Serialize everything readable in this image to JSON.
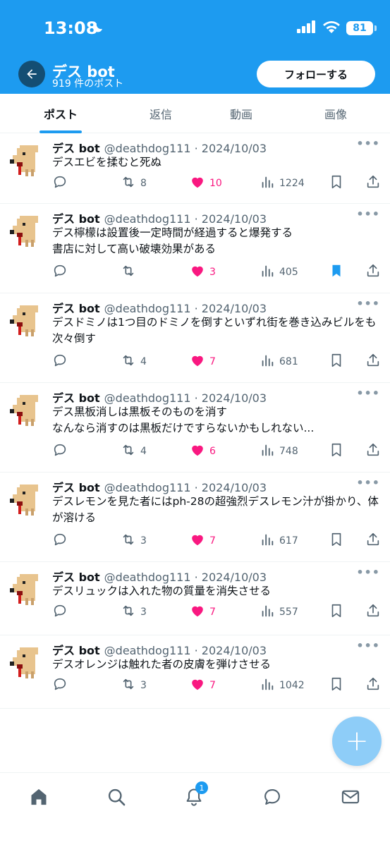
{
  "status": {
    "time": "13:08",
    "battery": "81"
  },
  "header": {
    "name": "デス bot",
    "post_count": "919 件のポスト",
    "follow_label": "フォローする"
  },
  "tabs": [
    {
      "label": "ポスト",
      "active": true
    },
    {
      "label": "返信",
      "active": false
    },
    {
      "label": "動画",
      "active": false
    },
    {
      "label": "画像",
      "active": false
    }
  ],
  "colors": {
    "accent": "#1d9bf0",
    "like": "#f91880",
    "muted": "#536471"
  },
  "posts": [
    {
      "name": "デス bot",
      "handle": "@deathdog111 · 2024/10/03",
      "text": "デスエビを揉むと死ぬ",
      "retweets": "8",
      "likes": "10",
      "views": "1224",
      "bookmarked": false
    },
    {
      "name": "デス bot",
      "handle": "@deathdog111 · 2024/10/03",
      "text": "デス檸檬は設置後一定時間が経過すると爆発する\n書店に対して高い破壊効果がある",
      "retweets": "",
      "likes": "3",
      "views": "405",
      "bookmarked": true
    },
    {
      "name": "デス bot",
      "handle": "@deathdog111 · 2024/10/03",
      "text": "デスドミノは1つ目のドミノを倒すといずれ街を巻き込みビルをも次々倒す",
      "retweets": "4",
      "likes": "7",
      "views": "681",
      "bookmarked": false
    },
    {
      "name": "デス bot",
      "handle": "@deathdog111 · 2024/10/03",
      "text": "デス黒板消しは黒板そのものを消す\nなんなら消すのは黒板だけですらないかもしれない...",
      "retweets": "4",
      "likes": "6",
      "views": "748",
      "bookmarked": false
    },
    {
      "name": "デス bot",
      "handle": "@deathdog111 · 2024/10/03",
      "text": "デスレモンを見た者にはph-28の超強烈デスレモン汁が掛かり、体が溶ける",
      "retweets": "3",
      "likes": "7",
      "views": "617",
      "bookmarked": false
    },
    {
      "name": "デス bot",
      "handle": "@deathdog111 · 2024/10/03",
      "text": "デスリュックは入れた物の質量を消失させる",
      "retweets": "3",
      "likes": "7",
      "views": "557",
      "bookmarked": false
    },
    {
      "name": "デス bot",
      "handle": "@deathdog111 · 2024/10/03",
      "text": "デスオレンジは触れた者の皮膚を弾けさせる",
      "retweets": "3",
      "likes": "7",
      "views": "1042",
      "bookmarked": false
    }
  ],
  "nav": {
    "notification_badge": "1"
  },
  "fab_label": "+"
}
